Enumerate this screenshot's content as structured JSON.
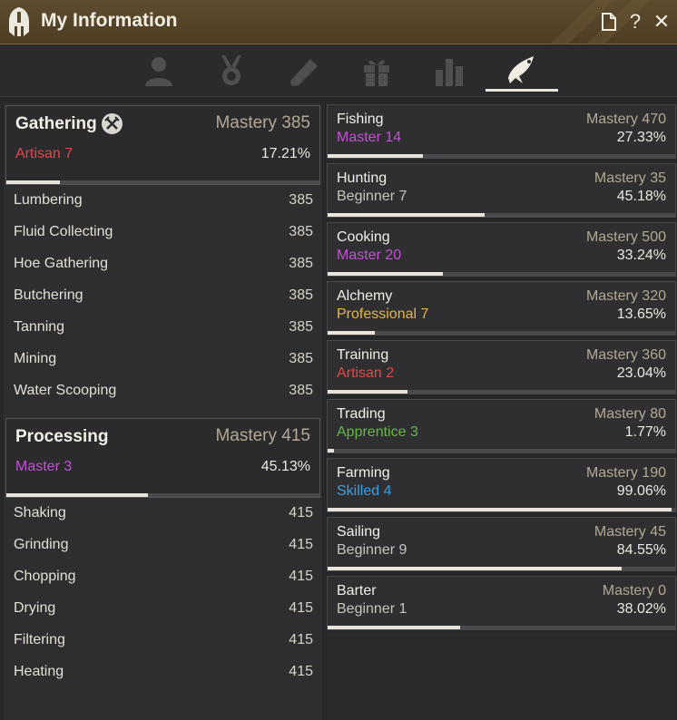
{
  "window": {
    "title": "My Information"
  },
  "titlebar_buttons": {
    "doc_icon": "document-icon",
    "help": "?",
    "close": "✕"
  },
  "tabs": [
    {
      "icon": "profile-icon",
      "active": false
    },
    {
      "icon": "medal-icon",
      "active": false
    },
    {
      "icon": "scroll-icon",
      "active": false
    },
    {
      "icon": "gift-icon",
      "active": false
    },
    {
      "icon": "stats-bars-icon",
      "active": false
    },
    {
      "icon": "fish-life-skill-icon",
      "active": true
    }
  ],
  "gathering": {
    "title": "Gathering",
    "mastery_label": "Mastery",
    "mastery": "385",
    "grade": "Artisan",
    "grade_level": "7",
    "percent": "17.21%",
    "progress": 0.1721,
    "items": [
      {
        "name": "Lumbering",
        "value": "385"
      },
      {
        "name": "Fluid Collecting",
        "value": "385"
      },
      {
        "name": "Hoe Gathering",
        "value": "385"
      },
      {
        "name": "Butchering",
        "value": "385"
      },
      {
        "name": "Tanning",
        "value": "385"
      },
      {
        "name": "Mining",
        "value": "385"
      },
      {
        "name": "Water Scooping",
        "value": "385"
      }
    ]
  },
  "processing": {
    "title": "Processing",
    "mastery_label": "Mastery",
    "mastery": "415",
    "grade": "Master",
    "grade_level": "3",
    "percent": "45.13%",
    "progress": 0.4513,
    "items": [
      {
        "name": "Shaking",
        "value": "415"
      },
      {
        "name": "Grinding",
        "value": "415"
      },
      {
        "name": "Chopping",
        "value": "415"
      },
      {
        "name": "Drying",
        "value": "415"
      },
      {
        "name": "Filtering",
        "value": "415"
      },
      {
        "name": "Heating",
        "value": "415"
      }
    ]
  },
  "skills": [
    {
      "name": "Fishing",
      "mastery": "Mastery 470",
      "grade": "Master",
      "level": "14",
      "percent": "27.33%",
      "progress": 0.2733,
      "grade_class": "master"
    },
    {
      "name": "Hunting",
      "mastery": "Mastery 35",
      "grade": "Beginner",
      "level": "7",
      "percent": "45.18%",
      "progress": 0.4518,
      "grade_class": "beginner"
    },
    {
      "name": "Cooking",
      "mastery": "Mastery 500",
      "grade": "Master",
      "level": "20",
      "percent": "33.24%",
      "progress": 0.3324,
      "grade_class": "master"
    },
    {
      "name": "Alchemy",
      "mastery": "Mastery 320",
      "grade": "Professional",
      "level": "7",
      "percent": "13.65%",
      "progress": 0.1365,
      "grade_class": "professional"
    },
    {
      "name": "Training",
      "mastery": "Mastery 360",
      "grade": "Artisan",
      "level": "2",
      "percent": "23.04%",
      "progress": 0.2304,
      "grade_class": "artisan"
    },
    {
      "name": "Trading",
      "mastery": "Mastery 80",
      "grade": "Apprentice",
      "level": "3",
      "percent": "1.77%",
      "progress": 0.0177,
      "grade_class": "apprentice"
    },
    {
      "name": "Farming",
      "mastery": "Mastery 190",
      "grade": "Skilled",
      "level": "4",
      "percent": "99.06%",
      "progress": 0.9906,
      "grade_class": "skilled"
    },
    {
      "name": "Sailing",
      "mastery": "Mastery 45",
      "grade": "Beginner",
      "level": "9",
      "percent": "84.55%",
      "progress": 0.8455,
      "grade_class": "beginner"
    },
    {
      "name": "Barter",
      "mastery": "Mastery 0",
      "grade": "Beginner",
      "level": "1",
      "percent": "38.02%",
      "progress": 0.3802,
      "grade_class": "beginner"
    }
  ],
  "colors": {
    "artisan": "#e04848",
    "master": "#c44fd6",
    "beginner": "#c8c4bc",
    "professional": "#e2b54a",
    "apprentice": "#6ab54a",
    "skilled": "#3a9ee0",
    "titlebar": "#5e4c2e"
  }
}
